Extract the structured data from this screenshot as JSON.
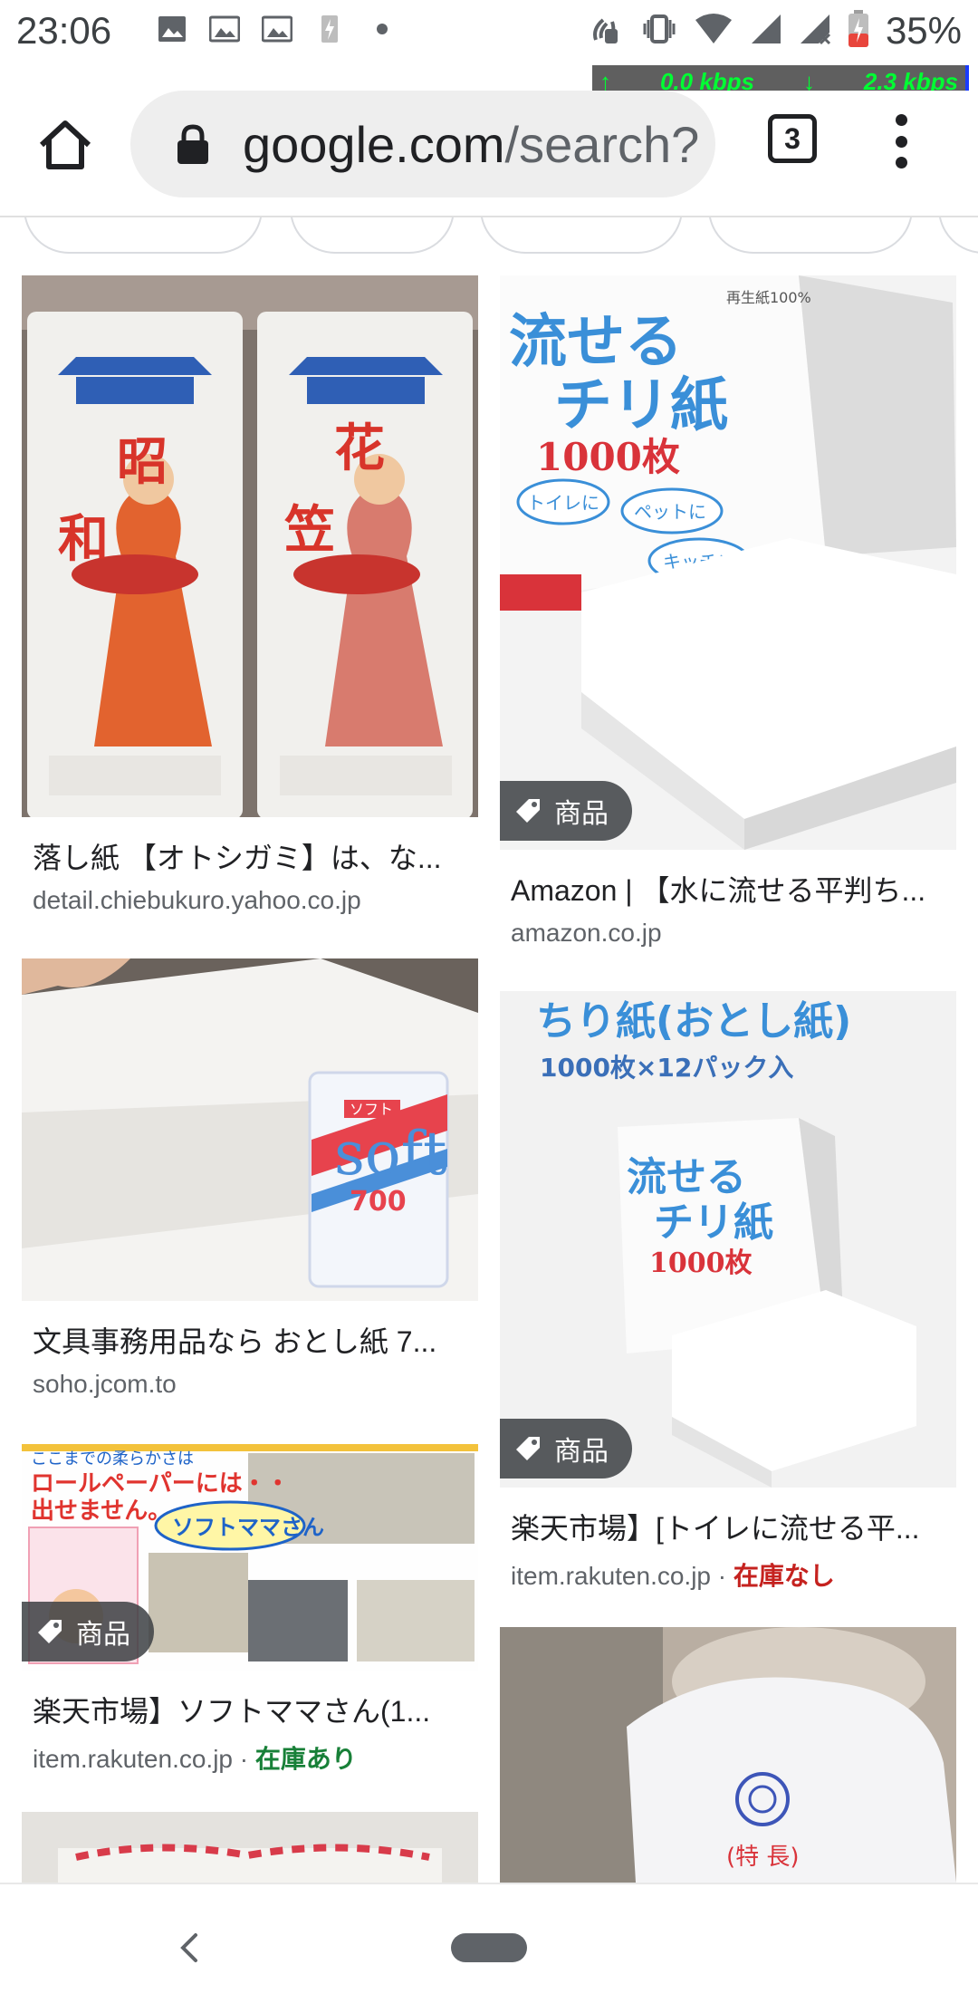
{
  "status_bar": {
    "time": "23:06",
    "battery": "35%",
    "icons_left": [
      "image-icon",
      "image-icon",
      "image-icon",
      "flash-icon",
      "dot-icon"
    ],
    "icons_right": [
      "nfc-icon",
      "vibrate-icon",
      "wifi-icon",
      "signal-icon",
      "signal-x-icon",
      "battery-icon"
    ]
  },
  "net_speed": {
    "up": "0.0 kbps",
    "down": "2.3 kbps"
  },
  "browser": {
    "url_host": "google.com",
    "url_rest": "/search?",
    "tab_count": "3"
  },
  "results": {
    "left": [
      {
        "title": "落し紙 【オトシガミ】は、な...",
        "source": "detail.chiebukuro.yahoo.co.jp"
      },
      {
        "title": "文具事務用品なら おとし紙 7...",
        "source": "soho.jcom.to"
      },
      {
        "title": "楽天市場】ソフトママさん(1...",
        "source": "item.rakuten.co.jp",
        "separator": " · ",
        "stock": "在庫あり",
        "badge": "商品"
      }
    ],
    "right": [
      {
        "title": "Amazon | 【水に流せる平判ち...",
        "source": "amazon.co.jp",
        "badge": "商品"
      },
      {
        "title": "楽天市場】[トイレに流せる平...",
        "source": "item.rakuten.co.jp",
        "separator": " · ",
        "stock": "在庫なし",
        "badge": "商品"
      }
    ]
  },
  "image_text": {
    "showa": [
      "昭",
      "和"
    ],
    "hanagasa": [
      "花",
      "笠"
    ],
    "nagaseru": "流せる",
    "chirigami": "チリ紙",
    "maisu": "1000枚",
    "toilet": "トイレに",
    "pet": "ペットに",
    "kitchen": "キッチン",
    "recycled": "再生紙100%",
    "chirigami_otoshi": "ちり紙(おとし紙)",
    "pack": "1000枚×12パック入",
    "soft_label": "ソフト",
    "soft": "soft",
    "soft_num": "700",
    "mama_line1": "ここまでの柔らかさは",
    "mama_line2": "ロールペーパーには・・",
    "mama_line3": "出せません。",
    "mama_brand": "ソフトママさん",
    "tokucho": "(特 長)"
  }
}
